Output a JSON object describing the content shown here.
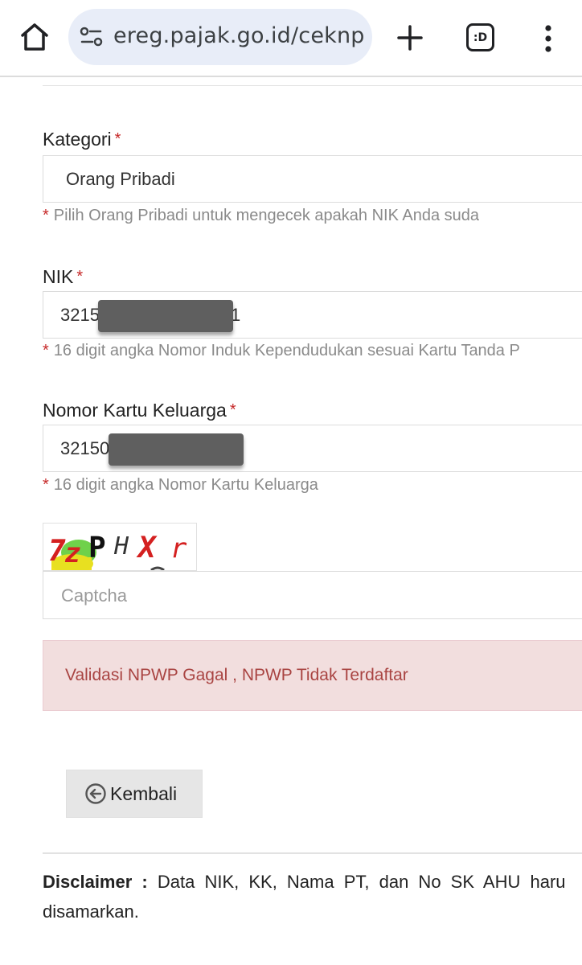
{
  "browser": {
    "url": "ereg.pajak.go.id/ceknp",
    "tabs_label": ":D",
    "icons": {
      "home": "home-icon",
      "site_info": "site-settings-icon",
      "new_tab": "plus-icon",
      "tabs": "tab-switcher-icon",
      "menu": "more-vert-icon"
    }
  },
  "form": {
    "kategori": {
      "label": "Kategori",
      "required_mark": "*",
      "value": "Orang Pribadi",
      "help": "Pilih Orang Pribadi untuk mengecek apakah NIK Anda suda"
    },
    "nik": {
      "label": "NIK",
      "required_mark": "*",
      "value_prefix": "3215",
      "value_suffix": "1",
      "help": "16 digit angka Nomor Induk Kependudukan sesuai Kartu Tanda P"
    },
    "kk": {
      "label": "Nomor Kartu Keluarga",
      "required_mark": "*",
      "value_prefix": "32150",
      "help": "16 digit angka Nomor Kartu Keluarga"
    },
    "captcha": {
      "image_text": "7zPHXr",
      "placeholder": "Captcha"
    }
  },
  "alert": {
    "message": "Validasi NPWP Gagal , NPWP Tidak Terdaftar",
    "color": "#a94442",
    "background": "#f2dede"
  },
  "back_button": {
    "label": "Kembali",
    "icon": "arrow-left-circle-icon"
  },
  "disclaimer": {
    "label": "Disclaimer :",
    "line1": "Data NIK, KK, Nama PT, dan No SK AHU haru",
    "line2": "disamarkan."
  },
  "colors": {
    "required": "#c62828",
    "urlbar": "#e8edf8",
    "help_text": "#8a8a8a"
  }
}
